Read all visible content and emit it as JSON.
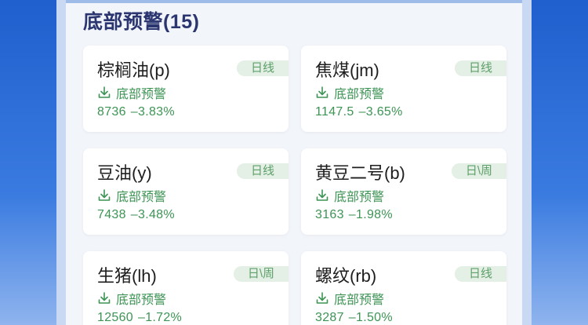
{
  "section": {
    "title": "底部预警(15)"
  },
  "colors": {
    "green": "#3d9455",
    "tag_bg": "#e4efe5",
    "title": "#2b3670",
    "blue": "#2f6fd6"
  },
  "cards": [
    {
      "name": "棕榈油(p)",
      "tag": "日线",
      "alert": "底部预警",
      "price": "8736",
      "change": "–3.83%"
    },
    {
      "name": "焦煤(jm)",
      "tag": "日线",
      "alert": "底部预警",
      "price": "1147.5",
      "change": "–3.65%"
    },
    {
      "name": "豆油(y)",
      "tag": "日线",
      "alert": "底部预警",
      "price": "7438",
      "change": "–3.48%"
    },
    {
      "name": "黄豆二号(b)",
      "tag": "日\\周",
      "alert": "底部预警",
      "price": "3163",
      "change": "–1.98%"
    },
    {
      "name": "生猪(lh)",
      "tag": "日\\周",
      "alert": "底部预警",
      "price": "12560",
      "change": "–1.72%"
    },
    {
      "name": "螺纹(rb)",
      "tag": "日线",
      "alert": "底部预警",
      "price": "3287",
      "change": "–1.50%"
    }
  ]
}
